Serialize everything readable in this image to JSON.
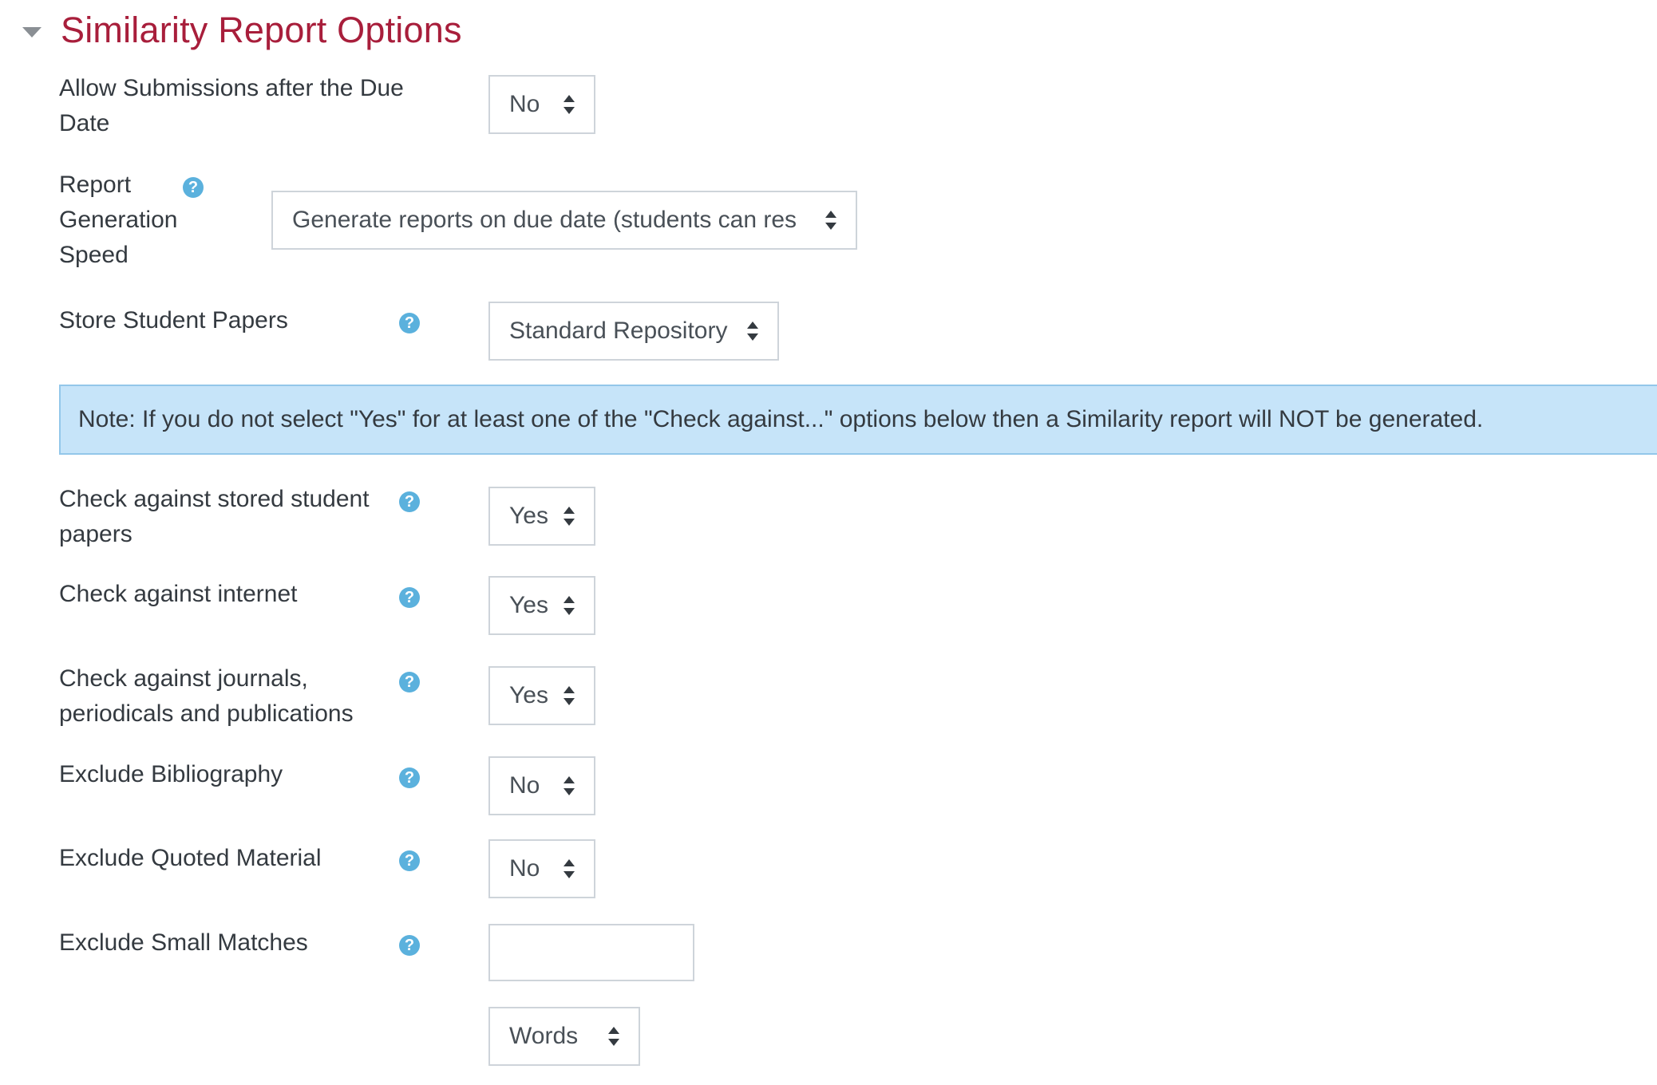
{
  "section": {
    "title": "Similarity Report Options"
  },
  "help_glyph": "?",
  "fields": {
    "allow_late": {
      "label_line1": "Allow Submissions after the Due",
      "label_line2": "Date",
      "value": "No"
    },
    "report_speed": {
      "label_line1": "Report",
      "label_line2": "Generation",
      "label_line3": "Speed",
      "value": "Generate reports on due date (students can res"
    },
    "store_papers": {
      "label": "Store Student Papers",
      "value": "Standard Repository"
    },
    "check_stored": {
      "label_line1": "Check against stored student",
      "label_line2": "papers",
      "value": "Yes"
    },
    "check_internet": {
      "label": "Check against internet",
      "value": "Yes"
    },
    "check_journals": {
      "label_line1": "Check against journals,",
      "label_line2": "periodicals and publications",
      "value": "Yes"
    },
    "exclude_bibliography": {
      "label": "Exclude Bibliography",
      "value": "No"
    },
    "exclude_quoted": {
      "label": "Exclude Quoted Material",
      "value": "No"
    },
    "exclude_small": {
      "label": "Exclude Small Matches",
      "value": "",
      "unit": "Words"
    }
  },
  "note": {
    "text": "Note: If you do not select \"Yes\" for at least one of the \"Check against...\" options below then a Similarity report will NOT be generated."
  },
  "colors": {
    "title": "#a81e3b",
    "help": "#5bb1dd",
    "note_bg": "#c6e4f9",
    "note_border": "#93c7ea"
  }
}
